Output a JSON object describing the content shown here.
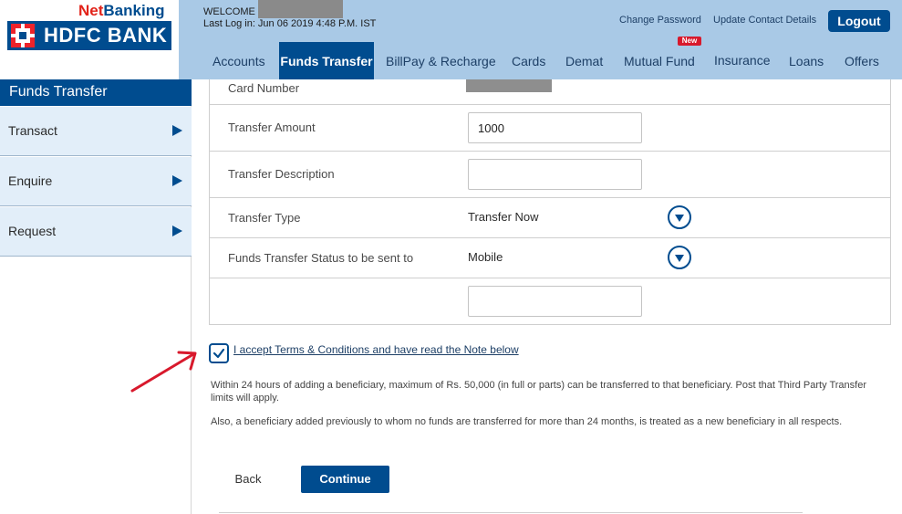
{
  "header": {
    "brand_netbanking_a": "Net",
    "brand_netbanking_b": "Banking",
    "brand_bank": "HDFC BANK",
    "welcome": "WELCOME",
    "last_login": "Last Log in: Jun 06 2019 4:48 P.M. IST",
    "links": {
      "change_password": "Change Password",
      "update_contact": "Update Contact Details",
      "logout": "Logout"
    }
  },
  "nav": {
    "items": [
      {
        "label": "Accounts"
      },
      {
        "label": "Funds Transfer"
      },
      {
        "label": "BillPay & Recharge"
      },
      {
        "label": "Cards"
      },
      {
        "label": "Demat"
      },
      {
        "label": "Mutual Fund",
        "badge": "New"
      },
      {
        "label": "Insurance"
      },
      {
        "label": "Loans"
      },
      {
        "label": "Offers"
      }
    ],
    "active": "Funds Transfer"
  },
  "sidebar": {
    "title": "Funds Transfer",
    "items": [
      {
        "label": "Transact"
      },
      {
        "label": "Enquire"
      },
      {
        "label": "Request"
      }
    ]
  },
  "form": {
    "card_number_label": "Card Number",
    "amount_label": "Transfer Amount",
    "amount_value": "1000",
    "description_label": "Transfer Description",
    "description_value": "",
    "type_label": "Transfer Type",
    "type_value": "Transfer Now",
    "status_label": "Funds Transfer Status to be sent to",
    "status_value": "Mobile",
    "mobile_value": ""
  },
  "terms": {
    "checked": true,
    "label": "I accept Terms & Conditions and have read the Note below",
    "note1": "Within 24 hours of adding a beneficiary, maximum of Rs. 50,000 (in full or parts) can be transferred to that beneficiary. Post that Third Party Transfer limits will apply.",
    "note2": "Also, a beneficiary added previously to whom no funds are transferred for more than 24 months, is treated as a new beneficiary in all respects."
  },
  "actions": {
    "back": "Back",
    "continue": "Continue"
  },
  "colors": {
    "brand_blue": "#004c8f",
    "header_bg": "#a9c9e6",
    "brand_red": "#e2231a",
    "annotation_red": "#d8192c"
  }
}
